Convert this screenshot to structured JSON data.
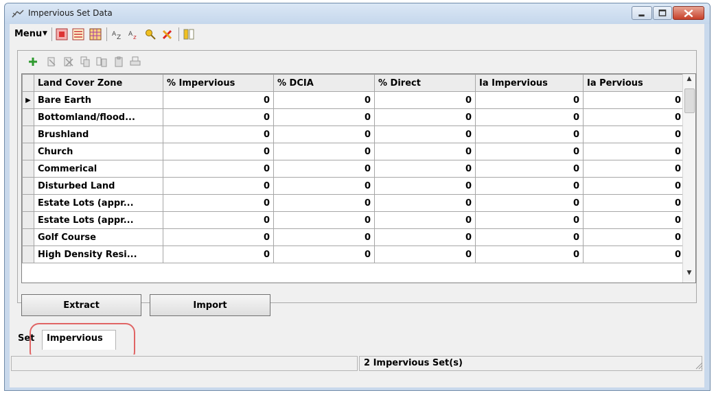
{
  "window": {
    "title": "Impervious Set Data",
    "controls": [
      "minimize",
      "maximize",
      "close"
    ],
    "close_color": "#c6402a"
  },
  "menubar": {
    "menu_label": "Menu",
    "toolbar_icons": [
      "grid-red-icon",
      "list-view-icon",
      "table-view-icon",
      "sort-az-icon",
      "sort-custom-icon",
      "key-find-icon",
      "tools-icon",
      "columns-icon"
    ]
  },
  "grid_toolbar": {
    "icons": [
      "add-row-icon",
      "delete-row-icon",
      "delete-all-icon",
      "copy-icon",
      "copy-columns-icon",
      "paste-icon",
      "print-icon"
    ]
  },
  "table": {
    "columns": [
      "Land Cover Zone",
      "% Impervious",
      "% DCIA",
      "% Direct",
      "Ia Impervious",
      "Ia Pervious"
    ],
    "rows": [
      {
        "zone": "Bare Earth",
        "values": [
          "0",
          "0",
          "0",
          "0",
          "0"
        ],
        "current": true
      },
      {
        "zone": "Bottomland/flood...",
        "values": [
          "0",
          "0",
          "0",
          "0",
          "0"
        ]
      },
      {
        "zone": "Brushland",
        "values": [
          "0",
          "0",
          "0",
          "0",
          "0"
        ]
      },
      {
        "zone": "Church",
        "values": [
          "0",
          "0",
          "0",
          "0",
          "0"
        ]
      },
      {
        "zone": "Commerical",
        "values": [
          "0",
          "0",
          "0",
          "0",
          "0"
        ]
      },
      {
        "zone": "Disturbed Land",
        "values": [
          "0",
          "0",
          "0",
          "0",
          "0"
        ]
      },
      {
        "zone": "Estate Lots (appr...",
        "values": [
          "0",
          "0",
          "0",
          "0",
          "0"
        ]
      },
      {
        "zone": "Estate Lots (appr...",
        "values": [
          "0",
          "0",
          "0",
          "0",
          "0"
        ]
      },
      {
        "zone": "Golf Course",
        "values": [
          "0",
          "0",
          "0",
          "0",
          "0"
        ]
      },
      {
        "zone": "High Density Resi...",
        "values": [
          "0",
          "0",
          "0",
          "0",
          "0"
        ]
      }
    ],
    "current_row_marker": "▶"
  },
  "buttons": {
    "extract": "Extract",
    "import": "Import"
  },
  "tabs": {
    "strip_label": "Set",
    "active_tab": "Impervious"
  },
  "status": {
    "left": "",
    "right": "2 Impervious Set(s)"
  },
  "colors": {
    "highlight_ring": "#e06464",
    "window_frame": "#c9d9ec"
  }
}
